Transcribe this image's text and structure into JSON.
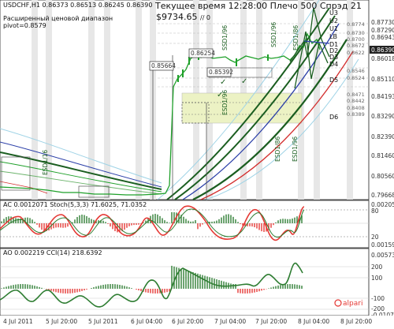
{
  "header": {
    "symbol_line": "USDCHF,H1  0.86373 0.86513 0.86245 0.86390",
    "range_label": "Расширенный ценовой диапазон",
    "pivot_label": "pivot=0.8579",
    "time_line": "Текущее время 12:28:00 Плечо 500 Спрэд 21",
    "balance": "$9734.65",
    "slash_zero": "// 0"
  },
  "main_axis": {
    "ticks": [
      "0.87730",
      "0.87290",
      "0.86943",
      "0.86390",
      "0.86018",
      "0.85110",
      "0.84193",
      "0.83290",
      "0.82390",
      "0.81460",
      "0.80560",
      "0.79668"
    ],
    "current_price": "0.86390"
  },
  "right_levels": [
    "U3",
    "U2",
    "U1",
    "LB",
    "D1",
    "D2",
    "D3",
    "D4",
    "D5",
    "D6"
  ],
  "faint_levels": [
    "0.8774",
    "0.8730",
    "0.8700",
    "0.8672",
    "0.8622",
    "0.8546",
    "0.8524",
    "0.8471",
    "0.8442",
    "0.8408",
    "0.8389"
  ],
  "price_labels": [
    "0.85664",
    "0.86254",
    "0.85392"
  ],
  "vertical_labels": [
    "ESD1/16",
    "SSD1/96",
    "SSD1/96",
    "ESD1/86",
    "ESD1/96",
    "ESD1/86",
    "ESD1/96"
  ],
  "stoch_panel": {
    "header": "AC 0.0012071  Stoch(5,3,3) 71.6025, 71.0352",
    "ticks": [
      "0.00205",
      "80",
      "20",
      "0.00159"
    ]
  },
  "cci_panel": {
    "header": "AO 0.002219  CCI(14) 218.6392",
    "ticks": [
      "0.00573",
      "200",
      "100",
      "-100",
      "-200",
      "-0.01077"
    ]
  },
  "time_axis": [
    "4 Jul 2011",
    "5 Jul 20:00",
    "5 Jul 2011",
    "6 Jul 04:00",
    "6 Jul 20:00",
    "7 Jul 04:00",
    "7 Jul 20:00",
    "8 Jul 04:00",
    "8 Jul 20:00"
  ],
  "watermark": "alpari",
  "colors": {
    "trend_green": "#1b5e20",
    "fan_blue": "#2b3fa8",
    "red_line": "#d32f2f",
    "price_line": "#1fa02a",
    "zone": "#ecf2c4",
    "osc_red": "#e53935",
    "osc_green": "#2e7d32"
  }
}
